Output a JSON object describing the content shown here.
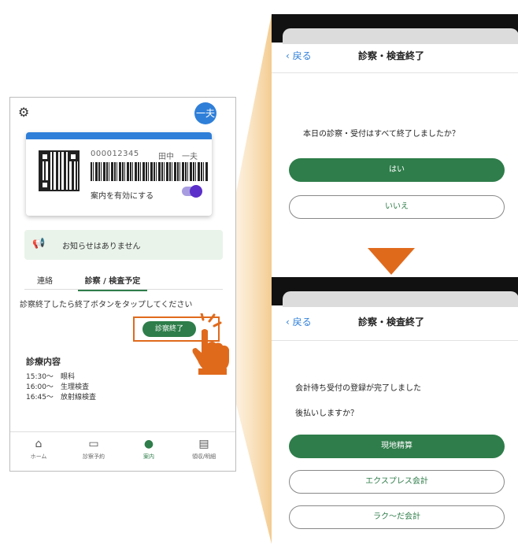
{
  "left": {
    "avatar": "一夫",
    "card": {
      "patient_id": "000012345",
      "patient_name": "田中　一夫",
      "toggle_label": "案内を有効にする",
      "toggle_on": true
    },
    "notice": "お知らせはありません",
    "tabs": [
      "連絡",
      "診察 / 検査予定"
    ],
    "active_tab": "診察 / 検査予定",
    "instruction": "診察終了したら終了ボタンをタップしてください",
    "end_button": "診察終了",
    "section_title": "診療内容",
    "schedule": [
      {
        "time": "15:30〜",
        "item": "眼科"
      },
      {
        "time": "16:00〜",
        "item": "生理検査"
      },
      {
        "time": "16:45〜",
        "item": "放射線検査"
      }
    ],
    "nav": [
      "ホーム",
      "診察予約",
      "案内",
      "領収/明細"
    ],
    "nav_active": "案内",
    "icons": {
      "settings": "gear-icon",
      "notice": "megaphone-icon",
      "nav": [
        "home-icon",
        "calendar-icon",
        "pin-icon",
        "receipt-icon"
      ]
    }
  },
  "screen1": {
    "back": "戻る",
    "title": "診察・検査終了",
    "question": "本日の診察・受付はすべて終了しましたか？",
    "yes": "はい",
    "no": "いいえ"
  },
  "screen2": {
    "back": "戻る",
    "title": "診察・検査終了",
    "message": "会計待ち受付の登録が完了しました",
    "question": "後払いしますか？",
    "options": [
      "現地精算",
      "エクスプレス会計",
      "ラク〜だ会計"
    ]
  },
  "colors": {
    "green": "#2e7d4a",
    "blue": "#2f7fd9",
    "orange": "#e06a1c",
    "beam": "#f3c98a"
  }
}
